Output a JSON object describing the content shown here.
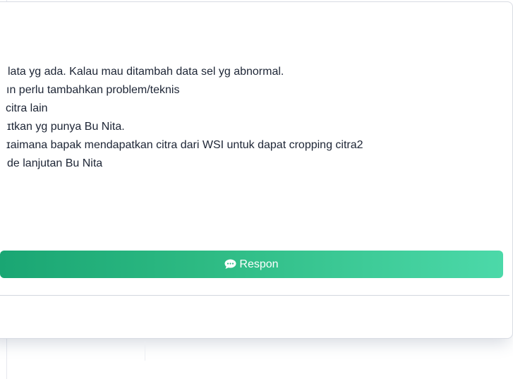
{
  "comment_card": {
    "lines": [
      "lata yg ada. Kalau mau ditambah data sel yg abnormal.",
      "ın perlu tambahkan problem/teknis",
      " citra lain",
      "ɪtkan yg punya Bu Nita.",
      "ɪaimana bapak mendapatkan citra dari WSI untuk dapat cropping citra2",
      "de lanjutan Bu Nita"
    ],
    "respond_button": {
      "label": "Respon",
      "icon": "comment-icon"
    }
  },
  "colors": {
    "button_gradient_start": "#1aa673",
    "button_gradient_end": "#4cd9a9",
    "text": "#1d2535"
  }
}
